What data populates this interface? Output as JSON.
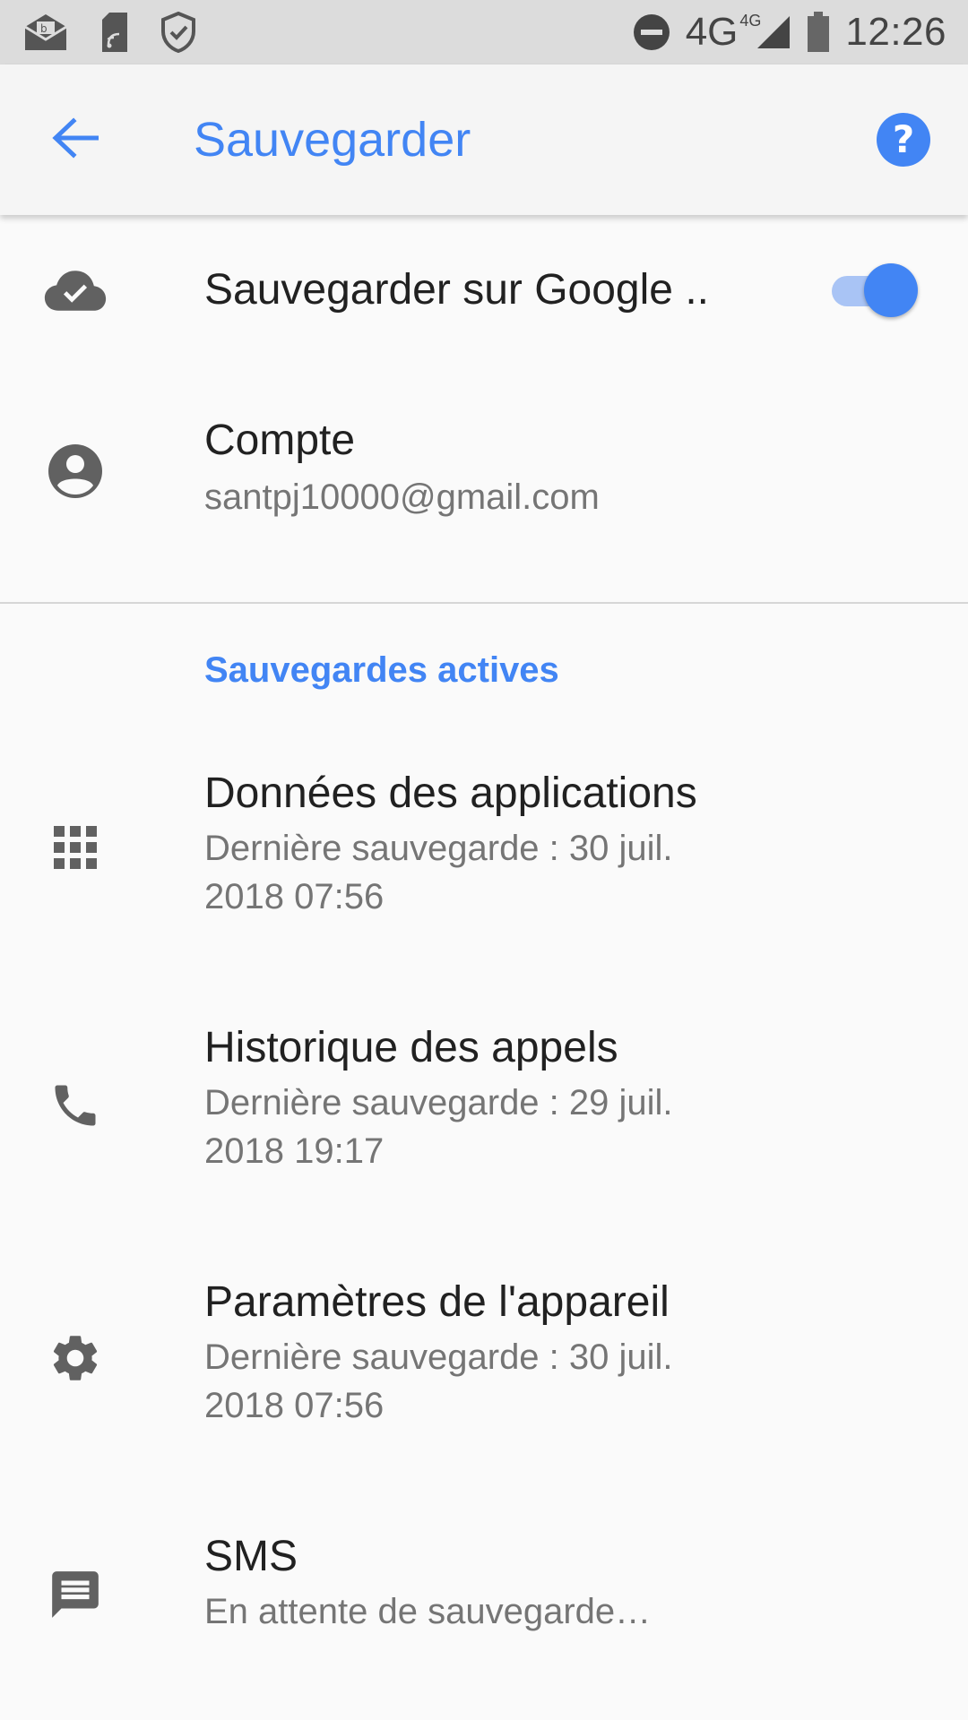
{
  "status_bar": {
    "network": "4G",
    "network_badge": "4G",
    "time": "12:26",
    "icons": [
      "email-icon",
      "sim-icon",
      "shield-icon",
      "do-not-disturb-icon",
      "signal-icon",
      "battery-icon"
    ]
  },
  "app_bar": {
    "title": "Sauvegarder",
    "back_icon": "arrow-back-icon",
    "help_icon": "help-icon"
  },
  "backup_toggle": {
    "label": "Sauvegarder sur Google ..",
    "enabled": true,
    "icon": "cloud-check-icon"
  },
  "account": {
    "label": "Compte",
    "value": "santpj10000@gmail.com",
    "icon": "account-circle-icon"
  },
  "section": {
    "title": "Sauvegardes actives"
  },
  "items": [
    {
      "label": "Données des applications",
      "line1": "Dernière sauvegarde : 30 juil.",
      "line2": "2018 07:56",
      "icon": "apps-grid-icon"
    },
    {
      "label": "Historique des appels",
      "line1": "Dernière sauvegarde : 29 juil.",
      "line2": "2018 19:17",
      "icon": "phone-icon"
    },
    {
      "label": "Paramètres de l'appareil",
      "line1": "Dernière sauvegarde : 30 juil.",
      "line2": "2018 07:56",
      "icon": "gear-icon"
    },
    {
      "label": "SMS",
      "line1": "En attente de sauvegarde…",
      "icon": "message-icon"
    }
  ],
  "colors": {
    "accent": "#4285f4",
    "toggle_track": "#a9c4f5",
    "primary_text": "#212121",
    "secondary_text": "#757575",
    "icon": "#616161"
  }
}
